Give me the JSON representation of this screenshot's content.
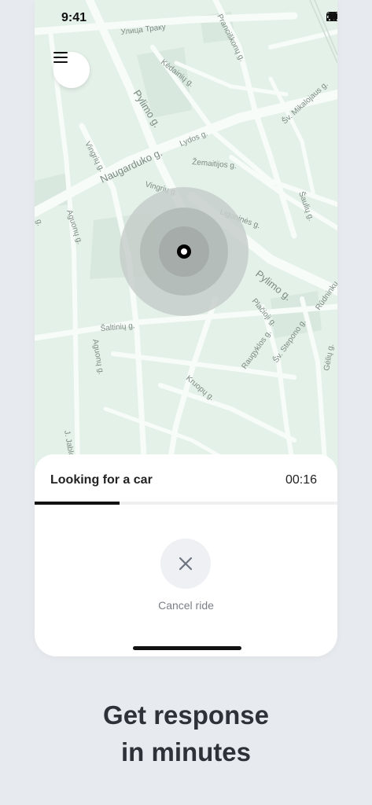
{
  "status_bar": {
    "time": "9:41"
  },
  "map": {
    "streets": [
      "Улица Траку",
      "Pranciškonų g.",
      "Kėdainių g.",
      "Pylimo g.",
      "Šv. Mikalojaus g.",
      "Vingrių g.",
      "Lydos g.",
      "Naugarduko g.",
      "Žemaitijos g.",
      "Vingrių g.",
      "Šaulių g.",
      "Ligoninės g.",
      "Aguonų g.",
      "Pylimo g.",
      "Plačioji g.",
      "Rūdninkų",
      "Šaltinių g.",
      "Raugyklos g.",
      "Šv. Stepono g.",
      "Aguonų g.",
      "Gėlių g.",
      "Kruopų g.",
      "J. Jablo",
      "g."
    ]
  },
  "sheet": {
    "title": "Looking for a car",
    "timer": "00:16",
    "progress": 0.28,
    "cancel_label": "Cancel ride"
  },
  "tagline": {
    "line1": "Get response",
    "line2": "in minutes"
  },
  "colors": {
    "map_bg": "#e4f1e9",
    "road": "#f7fcf9",
    "accent": "#111111",
    "page_bg": "#e7eaee"
  },
  "icons": {
    "menu": "hamburger-icon",
    "cancel": "close-icon"
  }
}
